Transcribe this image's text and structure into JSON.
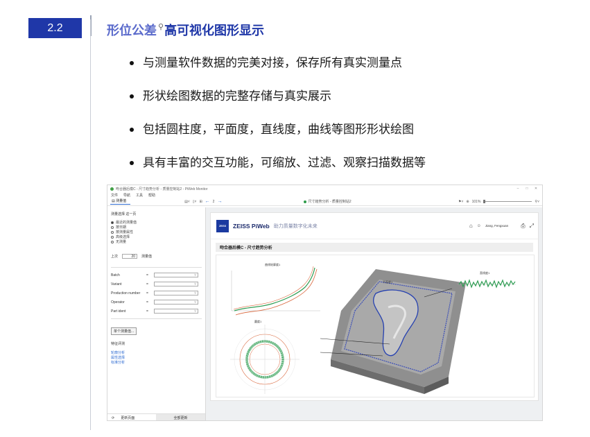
{
  "slide": {
    "section_number": "2.2",
    "heading_part1": "形位公差",
    "heading_part2": "高可视化图形显示",
    "bullets": [
      "与测量软件数据的完美对接，保存所有真实测量点",
      "形状绘图数据的完整存储与真实展示",
      "包括圆柱度，平面度，直线度，曲线等图形形状绘图",
      "具有丰富的交互功能，可缩放、过滤、观察扫描数据等"
    ]
  },
  "app": {
    "window_title": "吻合器后模C - 尺寸趋势分析 - 质量控制站2 - PiWeb Monitor",
    "menu": [
      "文件",
      "导航",
      "工具",
      "帮助"
    ],
    "toolbar": {
      "tab_label": "测量值",
      "page_counter": "2",
      "document_title": "尺寸趋势分析 - 质量控制站2",
      "zoom_level": "101%"
    },
    "left_panel": {
      "title": "测量选择 这一页",
      "options": [
        "最近的测量值",
        "按日期",
        "按测量属性",
        "高级选择",
        "无测量"
      ],
      "selected_index": 0,
      "recent_label": "上次",
      "recent_value": "20",
      "recent_unit": "测量值",
      "filters": [
        {
          "label": "Batch",
          "op": "="
        },
        {
          "label": "Variant",
          "op": "="
        },
        {
          "label": "Production number",
          "op": "="
        },
        {
          "label": "Operator",
          "op": "="
        },
        {
          "label": "Part ident",
          "op": "="
        }
      ],
      "single_button": "单个测量值...",
      "feature_section": "特征评测",
      "links": [
        "轮廓分析",
        "属性选择",
        "标准分析"
      ],
      "refresh_label": "更新页面",
      "select_all_label": "全部更新"
    },
    "report": {
      "logo_text": "ZEISS",
      "brand": "ZEISS PiWeb",
      "slogan": "助力质量数字化未来",
      "user": "Jiang, Fengxuan",
      "title": "吻合器后模C - 尺寸趋势分析",
      "labels": {
        "curve": "曲线轮廓度1",
        "flatness_top": "平面度1",
        "straightness": "直线度1",
        "roundness": "圆度1"
      }
    }
  }
}
